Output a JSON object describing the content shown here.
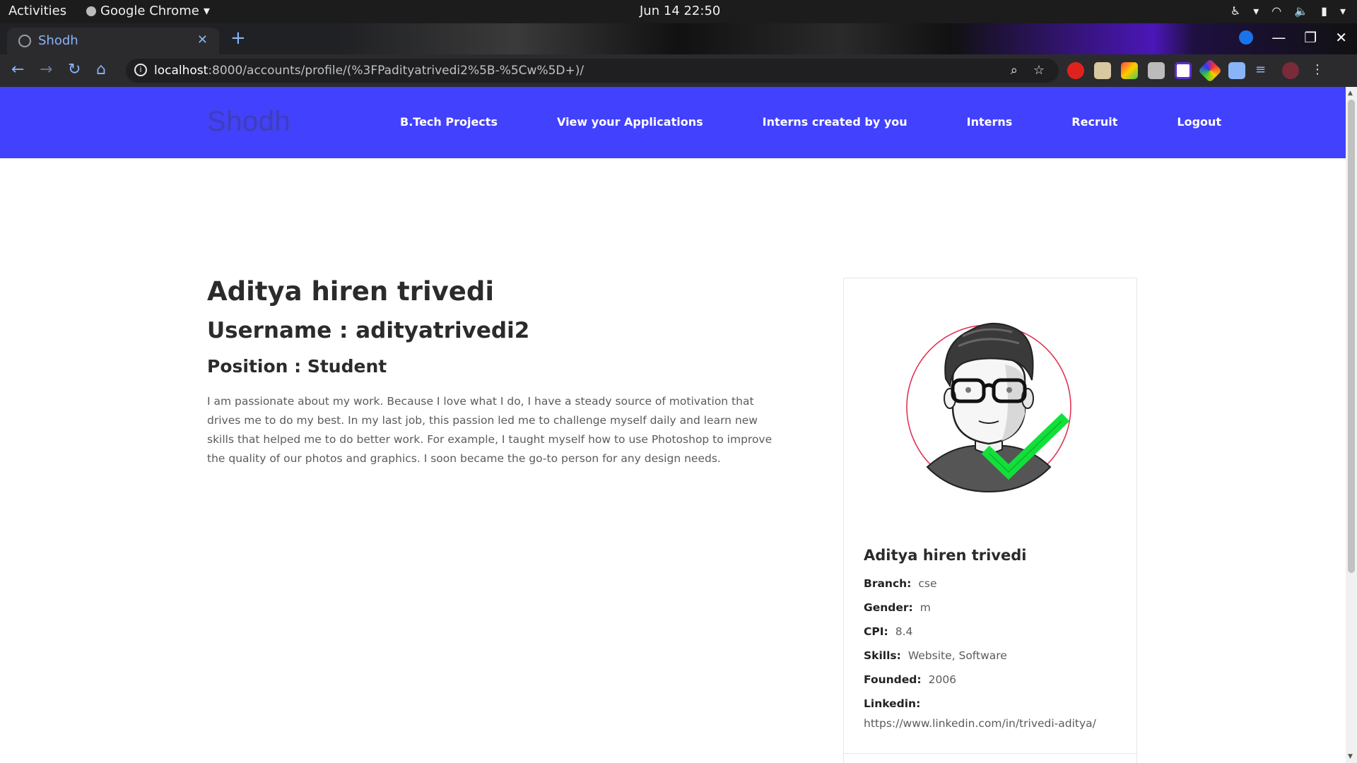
{
  "system": {
    "activities": "Activities",
    "app_name": "Google Chrome",
    "clock": "Jun 14  22:50"
  },
  "browser": {
    "tab_title": "Shodh",
    "url_host": "localhost",
    "url_rest": ":8000/accounts/profile/(%3FPadityatrivedi2%5B-%5Cw%5D+)/",
    "accent": "#8ab4f8"
  },
  "site": {
    "logo": "Shodh",
    "nav_color": "#4241fe",
    "menu": [
      {
        "label": "B.Tech Projects"
      },
      {
        "label": "View your Applications"
      },
      {
        "label": "Interns created by you"
      },
      {
        "label": "Interns"
      },
      {
        "label": "Recruit"
      },
      {
        "label": "Logout"
      }
    ]
  },
  "profile": {
    "name": "Aditya hiren trivedi",
    "username": "Username : adityatrivedi2",
    "position": "Position : Student",
    "bio": "I am passionate about my work. Because I love what I do, I have a steady source of motivation that drives me to do my best. In my last job, this passion led me to challenge myself daily and learn new skills that helped me to do better work. For example, I taught myself how to use Photoshop to improve the quality of our photos and graphics. I soon became the go-to person for any design needs."
  },
  "card": {
    "name": "Aditya hiren trivedi",
    "fields": [
      {
        "label": "Branch:",
        "value": "cse"
      },
      {
        "label": "Gender:",
        "value": "m"
      },
      {
        "label": "CPI:",
        "value": "8.4"
      },
      {
        "label": "Skills:",
        "value": "Website, Software"
      },
      {
        "label": "Founded:",
        "value": "2006"
      },
      {
        "label": "Linkedin:",
        "value": "https://www.linkedin.com/in/trivedi-aditya/"
      }
    ]
  }
}
